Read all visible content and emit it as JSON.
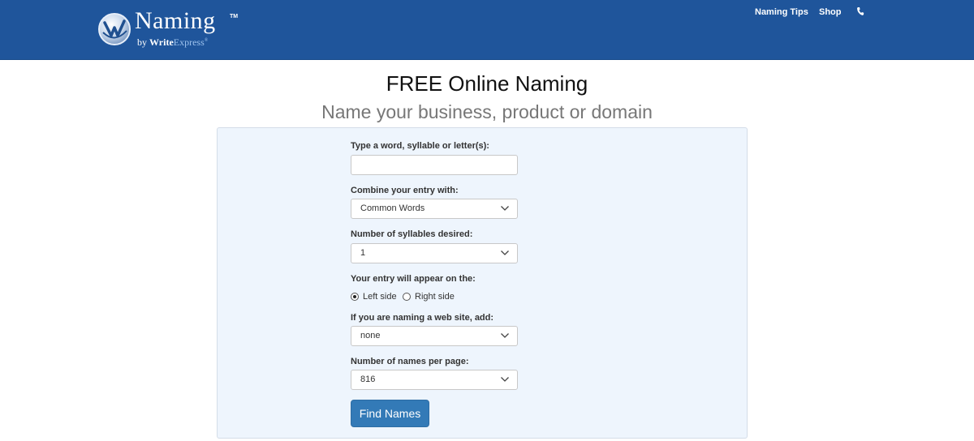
{
  "header": {
    "logo": {
      "wordmark": "Naming",
      "trademark": "TM",
      "by": "by",
      "write": "Write",
      "express": "Express",
      "registered": "®"
    },
    "nav": {
      "tips": "Naming Tips",
      "shop": "Shop",
      "phone_icon": "phone-icon"
    },
    "colors": {
      "bar": "#1f559b",
      "button": "#337ab7",
      "panel": "#eef5fd"
    }
  },
  "page": {
    "title": "FREE Online Naming",
    "subtitle": "Name your business, product or domain"
  },
  "form": {
    "word_label": "Type a word, syllable or letter(s):",
    "word_value": "",
    "combine_label": "Combine your entry with:",
    "combine_value": "Common Words",
    "syllables_label": "Number of syllables desired:",
    "syllables_value": "1",
    "position_label": "Your entry will appear on the:",
    "position_left": "Left side",
    "position_right": "Right side",
    "position_selected": "Left side",
    "website_label": "If you are naming a web site, add:",
    "website_value": "none",
    "perpage_label": "Number of names per page:",
    "perpage_value": "816",
    "submit": "Find Names"
  }
}
